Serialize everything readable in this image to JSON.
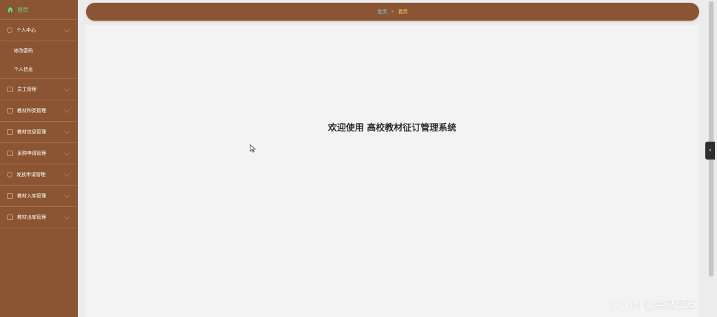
{
  "sidebar": {
    "home": "首页",
    "personal_center": "个人中心",
    "personal_sub": [
      "修改密码",
      "个人信息"
    ],
    "menus": [
      "员工管理",
      "教材种类管理",
      "教材信息管理",
      "采购申请管理",
      "发放申请管理",
      "教材入库管理",
      "教材出库管理"
    ]
  },
  "breadcrumb": {
    "link": "首页",
    "separator": "»",
    "current": "首页"
  },
  "welcome": "欢迎使用 高校教材征订管理系统",
  "toggle_icon": "‹",
  "watermark": "CSDN @海灵学姐",
  "icons": {
    "home": "home-icon",
    "person": "user-icon",
    "menu_icons": [
      "staff-icon",
      "category-icon",
      "info-icon",
      "purchase-icon",
      "distribute-icon",
      "inbound-icon",
      "outbound-icon"
    ]
  },
  "colors": {
    "sidebar_bg": "#8b5533",
    "home_active": "#5ee07a",
    "breadcrumb_link": "#7fd0ff",
    "breadcrumb_current": "#ffd27a"
  }
}
